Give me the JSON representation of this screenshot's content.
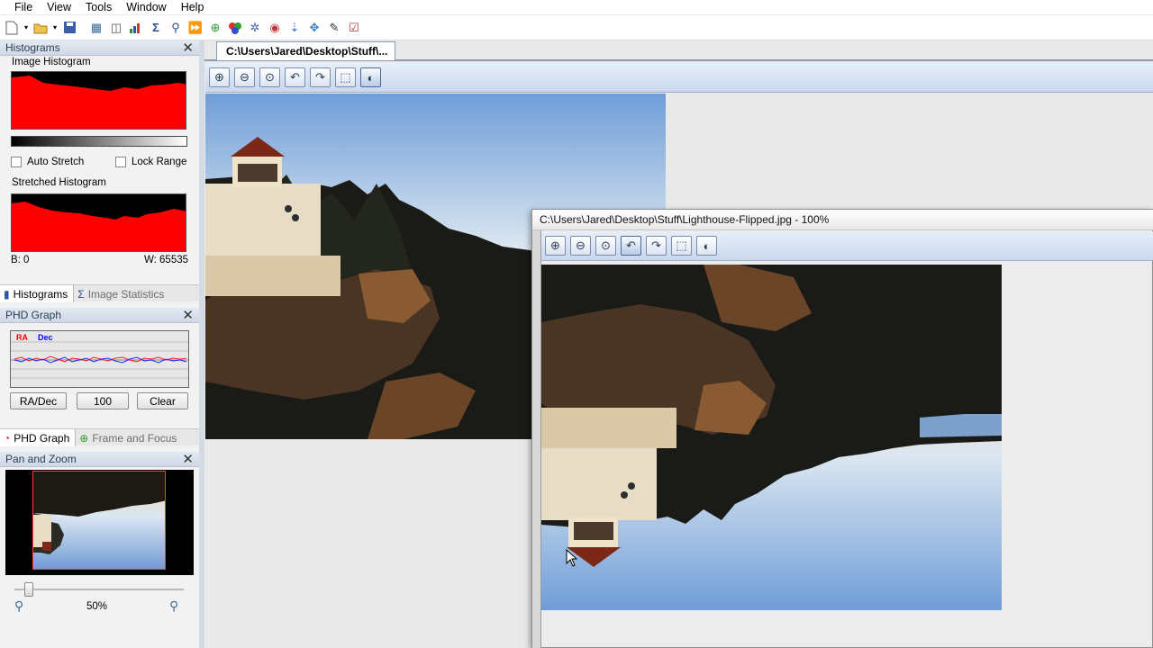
{
  "menu": [
    "File",
    "View",
    "Tools",
    "Window",
    "Help"
  ],
  "toolbar_icons": [
    "new-icon",
    "dropdown-icon",
    "open-icon",
    "dropdown-icon",
    "save-icon",
    "sep",
    "calibrate-icon",
    "process-icon",
    "chart-icon",
    "sigma-icon",
    "zoom-icon",
    "play-icon",
    "target-icon",
    "color-icon",
    "stack-icon",
    "align-icon",
    "arrow-icon",
    "move-icon",
    "brush-icon",
    "check-icon"
  ],
  "histograms_panel": {
    "title": "Histograms",
    "image_histogram_label": "Image Histogram",
    "auto_stretch_label": "Auto Stretch",
    "lock_range_label": "Lock Range",
    "stretched_histogram_label": "Stretched Histogram",
    "black_value": "B: 0",
    "white_value": "W: 65535",
    "tabs": [
      {
        "label": "Histograms",
        "icon": "histogram-icon"
      },
      {
        "label": "Image Statistics",
        "icon": "sigma-icon"
      }
    ]
  },
  "phd_panel": {
    "title": "PHD Graph",
    "legend_ra": "RA",
    "legend_dec": "Dec",
    "buttons": [
      "RA/Dec",
      "100",
      "Clear"
    ],
    "tabs": [
      {
        "label": "PHD Graph",
        "icon": "phd-icon"
      },
      {
        "label": "Frame and Focus",
        "icon": "focus-icon"
      }
    ],
    "colors": {
      "ra": "#ff0000",
      "dec": "#0000ff"
    }
  },
  "pan_zoom_panel": {
    "title": "Pan and Zoom",
    "zoom_level": "50%",
    "slider_value": 0.06
  },
  "document": {
    "tab_label": "C:\\Users\\Jared\\Desktop\\Stuff\\...",
    "float_title": "C:\\Users\\Jared\\Desktop\\Stuff\\Lighthouse-Flipped.jpg - 100%"
  },
  "image_toolbar_icons": [
    "zoom-in-icon",
    "zoom-out-icon",
    "zoom-fit-icon",
    "rotate-left-icon",
    "rotate-right-icon",
    "select-icon",
    "contrast-icon"
  ]
}
